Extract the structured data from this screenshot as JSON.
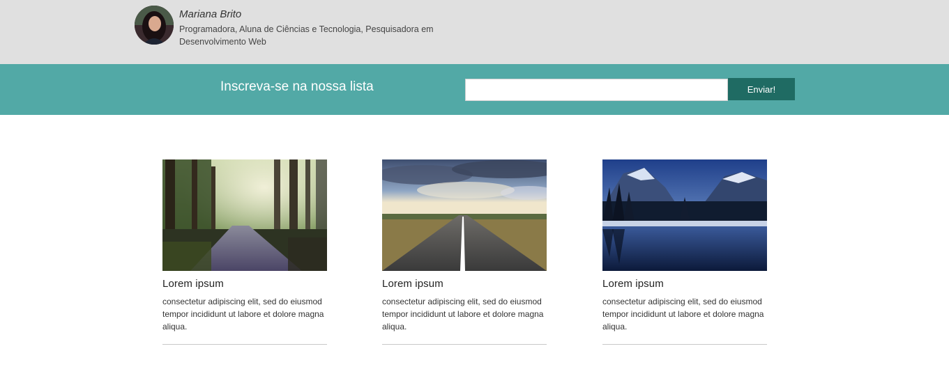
{
  "header": {
    "author_name": "Mariana Brito",
    "author_bio": "Programadora, Aluna de Ciências e Tecnologia, Pesquisadora em Desenvolvimento Web"
  },
  "subscribe": {
    "title": "Inscreva-se na nossa lista",
    "input_value": "",
    "button_label": "Enviar!"
  },
  "cards": [
    {
      "title": "Lorem ipsum",
      "text": "consectetur adipiscing elit, sed do eiusmod tempor incididunt ut labore et dolore magna aliqua."
    },
    {
      "title": "Lorem ipsum",
      "text": "consectetur adipiscing elit, sed do eiusmod tempor incididunt ut labore et dolore magna aliqua."
    },
    {
      "title": "Lorem ipsum",
      "text": "consectetur adipiscing elit, sed do eiusmod tempor incididunt ut labore et dolore magna aliqua."
    }
  ],
  "colors": {
    "header_bg": "#e0e0e0",
    "subscribe_bg": "#52a9a6",
    "button_bg": "#1f6b63"
  }
}
